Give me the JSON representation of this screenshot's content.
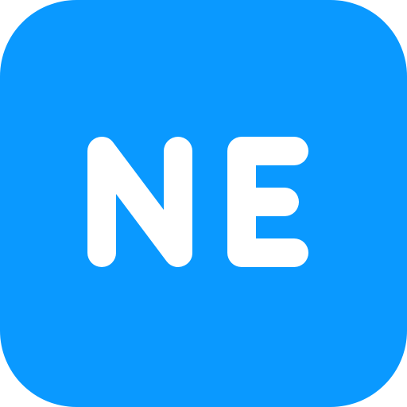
{
  "icon": {
    "name": "ne-badge-icon",
    "text": "NE",
    "background_color": "#0A99FF",
    "text_color": "#FFFFFF"
  }
}
